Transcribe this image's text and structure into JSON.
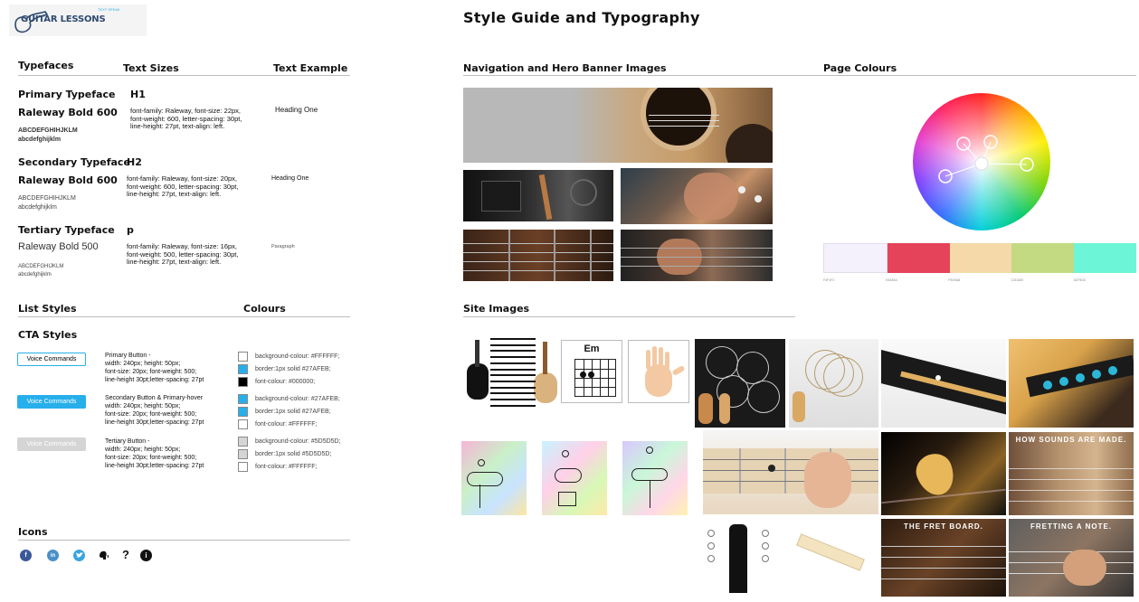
{
  "logo": {
    "text": "GUITAR LESSONS",
    "badge": "TEXT SPEAK"
  },
  "page_title": "Style Guide and Typography",
  "typefaces": {
    "heading": "Typefaces",
    "col_sizes": "Text Sizes",
    "col_example": "Text Example",
    "rows": [
      {
        "name": "Primary Typeface",
        "level": "H1",
        "font": "Raleway Bold 600",
        "upper": "ABCDEFGHIHJKLM",
        "lower": "abcdefghijklm",
        "spec1": "font-family: Raleway, font-size: 22px,",
        "spec2": "font-weight: 600, letter-spacing: 30pt,",
        "spec3": "line-height: 27pt, text-align: left.",
        "example": "Heading One"
      },
      {
        "name": "Secondary Typeface",
        "level": "H2",
        "font": "Raleway Bold 600",
        "upper": "ABCDEFGHIHJKLM",
        "lower": "abcdefghijklm",
        "spec1": "font-family: Raleway, font-size: 20px,",
        "spec2": "font-weight: 600, letter-spacing: 30pt,",
        "spec3": "line-height: 27pt, text-align: left.",
        "example": "Heading One"
      },
      {
        "name": "Tertiary Typeface",
        "level": "p",
        "font": "Raleway Bold 500",
        "upper": "ABCDEFGHIJKLM",
        "lower": "abcdefghijklm",
        "spec1": "font-family: Raleway, font-size: 16px,",
        "spec2": "font-weight: 500, letter-spacing: 30pt,",
        "spec3": "line-height: 27pt, text-align: left.",
        "example": "Paragraph"
      }
    ]
  },
  "list_styles": {
    "heading": "List Styles",
    "colours_heading": "Colours",
    "cta_heading": "CTA Styles"
  },
  "cta": [
    {
      "label": "Voice Commands",
      "bg": "#FFFFFF",
      "border": "#27AFEB",
      "fg": "#000000",
      "title": "Primary Button -",
      "l1": "width: 240px; height: 50px;",
      "l2": "font-size: 20px; font-weight: 500;",
      "l3": "line-height 30pt;letter-spacing: 27pt",
      "swatches": [
        {
          "color": "#FFFFFF",
          "label": "background-colour: #FFFFFF;"
        },
        {
          "color": "#27AFEB",
          "label": "border:1px solid #27AFEB;"
        },
        {
          "color": "#000000",
          "label": "font-colour: #000000;"
        }
      ]
    },
    {
      "label": "Voice Commands",
      "bg": "#27AFEB",
      "border": "#27AFEB",
      "fg": "#FFFFFF",
      "title": "Secondary Button & Primary-hover",
      "l1": "width: 240px; height: 50px;",
      "l2": "font-size: 20px; font-weight: 500;",
      "l3": "line-height 30pt;letter-spacing: 27pt",
      "swatches": [
        {
          "color": "#27AFEB",
          "label": "background-colour: #27AFEB;"
        },
        {
          "color": "#27AFEB",
          "label": "border:1px solid #27AFEB;"
        },
        {
          "color": "#FFFFFF",
          "label": "font-colour: #FFFFFF;"
        }
      ]
    },
    {
      "label": "Voice Commands",
      "bg": "#D5D5D5",
      "border": "#D5D5D5",
      "fg": "#FFFFFF",
      "title": "Tertiary Button -",
      "l1": "width: 240px; height: 50px;",
      "l2": "font-size: 20px; font-weight: 500;",
      "l3": "line-height 30pt;letter-spacing: 27pt",
      "swatches": [
        {
          "color": "#D5D5D5",
          "label": "background-colour: #5D5D5D;"
        },
        {
          "color": "#D5D5D5",
          "label": "border:1px solid #5D5D5D;"
        },
        {
          "color": "#FFFFFF",
          "label": "font-colour: #FFFFFF;"
        }
      ]
    }
  ],
  "icons": {
    "heading": "Icons",
    "items": [
      "facebook-icon",
      "linkedin-icon",
      "twitter-icon",
      "voice-icon",
      "help-icon",
      "info-icon"
    ]
  },
  "nav_images": {
    "heading": "Navigation and Hero Banner Images"
  },
  "page_colours": {
    "heading": "Page Colours",
    "palette": [
      "#F4F1FC",
      "#E5435A",
      "#F5D9A8",
      "#C3DA83",
      "#6CF5D6"
    ],
    "codes": [
      "F4F1FC",
      "E5435A",
      "F5D9A8",
      "C3DA83",
      "6CF5D6"
    ]
  },
  "site_images": {
    "heading": "Site Images",
    "captions": [
      "HOW SOUNDS ARE MADE.",
      "THE FRET BOARD.",
      "FRETTING A NOTE."
    ],
    "chord_name": "Em"
  }
}
